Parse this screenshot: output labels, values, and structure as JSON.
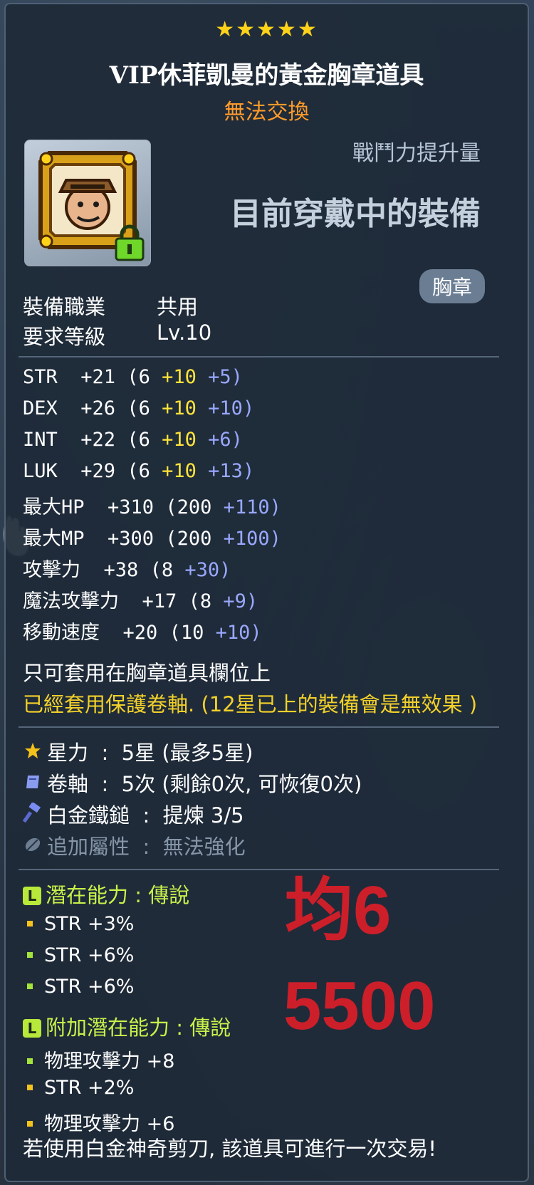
{
  "item": {
    "stars": "★★★★★",
    "name": "VIP休菲凱曼的黃金胸章道具",
    "trade": "無法交換",
    "power_label": "戰鬥力提升量",
    "equipped_label": "目前穿戴中的裝備",
    "slot": "胸章"
  },
  "requirements": [
    {
      "label": "裝備職業",
      "value": "共用"
    },
    {
      "label": "要求等級",
      "value": "Lv.10"
    }
  ],
  "stats": [
    {
      "name": "STR",
      "total": "+21",
      "base": "(6",
      "bonus": "+10",
      "enhance": "+5)"
    },
    {
      "name": "DEX",
      "total": "+26",
      "base": "(6",
      "bonus": "+10",
      "enhance": "+10)"
    },
    {
      "name": "INT",
      "total": "+22",
      "base": "(6",
      "bonus": "+10",
      "enhance": "+6)"
    },
    {
      "name": "LUK",
      "total": "+29",
      "base": "(6",
      "bonus": "+10",
      "enhance": "+13)"
    },
    {
      "name": "最大HP",
      "total": "+310",
      "base": "(200",
      "bonus": "",
      "enhance": "+110)"
    },
    {
      "name": "最大MP",
      "total": "+300",
      "base": "(200",
      "bonus": "",
      "enhance": "+100)"
    },
    {
      "name": "攻擊力",
      "total": "+38",
      "base": "(8",
      "bonus": "",
      "enhance": "+30)"
    },
    {
      "name": "魔法攻擊力",
      "total": "+17",
      "base": "(8",
      "bonus": "",
      "enhance": "+9)"
    },
    {
      "name": "移動速度",
      "total": "+20",
      "base": "(10",
      "bonus": "",
      "enhance": "+10)"
    }
  ],
  "notes": {
    "slot_only": "只可套用在胸章道具欄位上",
    "protect": "已經套用保護卷軸. (12星已上的裝備會是無效果 )"
  },
  "enhancements": [
    {
      "icon": "star-icon",
      "label": "星力",
      "value": "5星 (最多5星)",
      "dim": false
    },
    {
      "icon": "scroll-icon",
      "label": "卷軸",
      "value": "5次 (剩餘0次, 可恢復0次)",
      "dim": false
    },
    {
      "icon": "hammer-icon",
      "label": "白金鐵鎚",
      "value": "提煉 3/5",
      "dim": false
    },
    {
      "icon": "leaf-icon",
      "label": "追加屬性",
      "value": "無法強化",
      "dim": true
    }
  ],
  "potential": {
    "title": "潛在能力 : 傳說",
    "lines": [
      {
        "text": "STR +3%",
        "color": "yellow"
      },
      {
        "text": "STR +6%",
        "color": "green"
      },
      {
        "text": "STR +6%",
        "color": "green"
      }
    ]
  },
  "bonus_potential": {
    "title": "附加潛在能力 : 傳說",
    "lines": [
      {
        "text": "物理攻擊力 +8",
        "color": "green"
      },
      {
        "text": "STR +2%",
        "color": "yellow"
      },
      {
        "text": "物理攻擊力 +6",
        "color": "yellow"
      }
    ]
  },
  "overlay": {
    "line1": "均6",
    "line2": "5500",
    "color": "#cc1f2a"
  },
  "footer": "若使用白金神奇剪刀, 該道具可進行一次交易!",
  "colors": {
    "bonus_yellow": "#ffe43a",
    "enhance_blue": "#9aa8ff",
    "potential_green": "#c8f14a",
    "trade_orange": "#ff9b2a"
  }
}
